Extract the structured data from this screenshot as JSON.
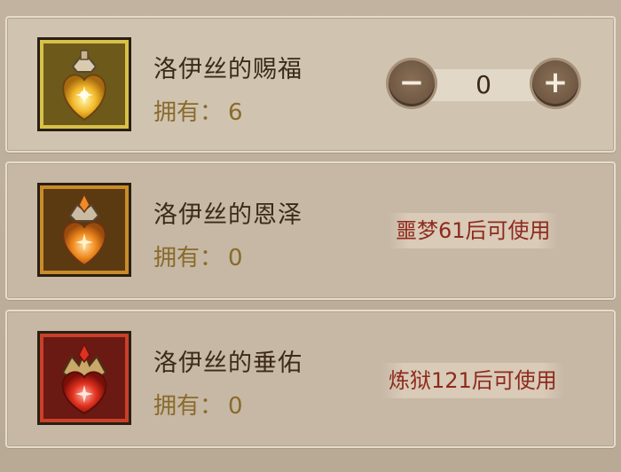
{
  "owned_label": "拥有：",
  "items": [
    {
      "name": "洛伊丝的赐福",
      "owned": "6",
      "quantity": "0",
      "decrement": "−",
      "increment": "+"
    },
    {
      "name": "洛伊丝的恩泽",
      "owned": "0",
      "unlock_text": "噩梦61后可使用"
    },
    {
      "name": "洛伊丝的垂佑",
      "owned": "0",
      "unlock_text": "炼狱121后可使用"
    }
  ],
  "colors": {
    "name_text": "#3a2a17",
    "owned_text": "#8a6a2c",
    "lock_text": "#8e2a1e"
  },
  "icons": [
    "gold-blessing-potion-icon",
    "orange-grace-potion-icon",
    "red-favor-potion-icon"
  ]
}
